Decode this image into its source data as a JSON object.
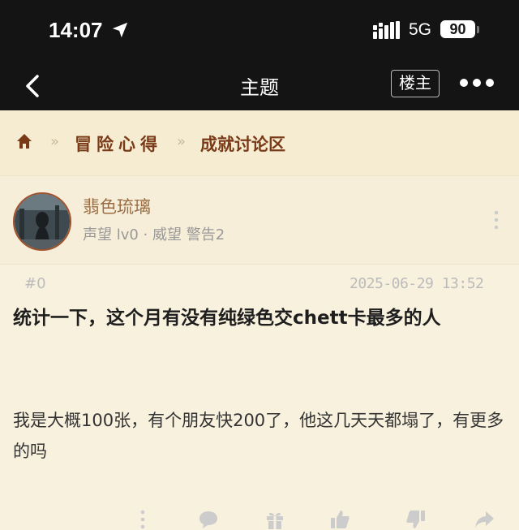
{
  "status_bar": {
    "time": "14:07",
    "network": "5G",
    "battery": "90"
  },
  "nav": {
    "title": "主题",
    "op_button": "楼主"
  },
  "breadcrumb": {
    "sep": "»",
    "item1": "冒险心得",
    "item2": "成就讨论区"
  },
  "post": {
    "author": "翡色琉璃",
    "meta": "声望 lv0 · 威望 警告2",
    "floor": "#0",
    "date": "2025-06-29 13:52",
    "title": "统计一下，这个月有没有纯绿色交chett卡最多的人",
    "body": "我是大概100张，有个朋友快200了，他这几天天都塌了，有更多的吗"
  },
  "icons": [
    "location-arrow-icon",
    "signal-icon",
    "back-icon",
    "more-icon",
    "home-icon",
    "kebab-icon",
    "comment-icon",
    "gift-icon",
    "thumbs-up-icon",
    "thumbs-down-icon",
    "share-icon"
  ],
  "colors": {
    "dark": "#141414",
    "accent": "#7a3a18",
    "background": "#f6efdc"
  }
}
